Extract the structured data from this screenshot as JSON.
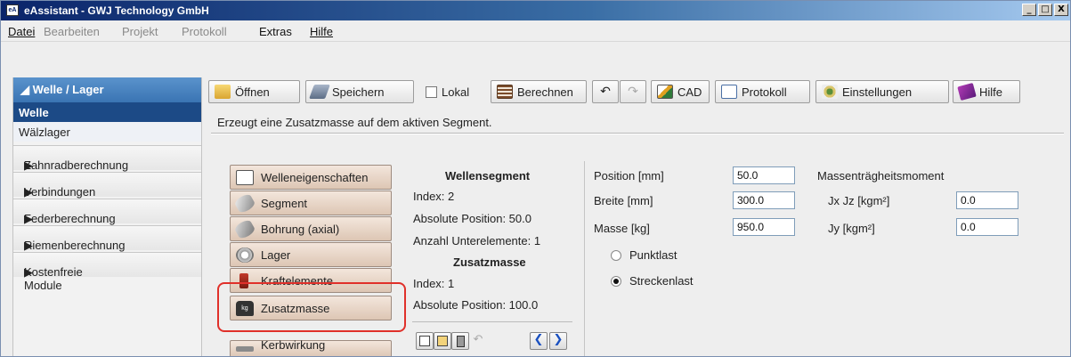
{
  "window": {
    "title": "eAssistant - GWJ Technology GmbH",
    "icon": "eA"
  },
  "window_controls": {
    "minimize": "_",
    "maximize": "□",
    "close": "X"
  },
  "menu": [
    {
      "label": "Datei",
      "disabled": false
    },
    {
      "label": "Bearbeiten",
      "disabled": true
    },
    {
      "label": "Projekt",
      "disabled": true
    },
    {
      "label": "Protokoll",
      "disabled": true
    },
    {
      "label": "Extras",
      "disabled": false
    },
    {
      "label": "Hilfe",
      "disabled": false
    }
  ],
  "nav": {
    "header": "◢ Welle / Lager",
    "subitems": [
      "Welle",
      "Wälzlager"
    ],
    "categories": [
      "Zahnradberechnung",
      "Verbindungen",
      "Federberechnung",
      "Riemenberechnung",
      "Kostenfreie Module"
    ],
    "arrow": "▶"
  },
  "toolbar": {
    "open": "Öffnen",
    "save": "Speichern",
    "local": "Lokal",
    "calculate": "Berechnen",
    "cad": "CAD",
    "protocol": "Protokoll",
    "settings": "Einstellungen",
    "help": "Hilfe"
  },
  "status": "Erzeugt eine Zusatzmasse auf dem aktiven Segment.",
  "element_buttons": [
    "Welleneigenschaften",
    "Segment",
    "Bohrung (axial)",
    "Lager",
    "Kraftelemente",
    "Zusatzmasse",
    "Kerbwirkung"
  ],
  "segment_info": {
    "title": "Wellensegment",
    "index": "Index: 2",
    "abs_pos": "Absolute Position:  50.0",
    "sub_count": "Anzahl Unterelemente: 1"
  },
  "mass_info": {
    "title": "Zusatzmasse",
    "index": "Index: 1",
    "abs_pos": "Absolute Position:  100.0"
  },
  "form": {
    "position_label": "Position [mm]",
    "position_value": "50.0",
    "width_label": "Breite [mm]",
    "width_value": "300.0",
    "mass_label": "Masse [kg]",
    "mass_value": "950.0",
    "point_load": "Punktlast",
    "line_load": "Streckenlast",
    "selected_load": "Streckenlast",
    "inertia_title": "Massenträgheitsmoment",
    "jxjz_label": "Jx Jz [kgm²]",
    "jxjz_value": "0.0",
    "jy_label": "Jy [kgm²]",
    "jy_value": "0.0"
  }
}
